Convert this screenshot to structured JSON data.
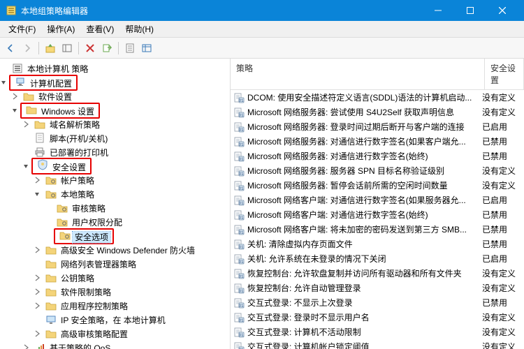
{
  "window": {
    "title": "本地组策略编辑器"
  },
  "menu": {
    "file": "文件(F)",
    "action": "操作(A)",
    "view": "查看(V)",
    "help": "帮助(H)"
  },
  "tree": {
    "root_label": "本地计算机 策略",
    "computer_config": "计算机配置",
    "software_settings": "软件设置",
    "windows_settings": "Windows 设置",
    "name_resolution": "域名解析策略",
    "scripts": "脚本(开机/关机)",
    "deployed_printers": "已部署的打印机",
    "security_settings": "安全设置",
    "account_policies": "帐户策略",
    "local_policies": "本地策略",
    "audit_policy": "审核策略",
    "user_rights": "用户权限分配",
    "security_options": "安全选项",
    "windows_defender_fw": "高级安全 Windows Defender 防火墙",
    "network_list_mgr": "网络列表管理器策略",
    "public_key": "公钥策略",
    "software_restriction": "软件限制策略",
    "app_control": "应用程序控制策略",
    "ip_security": "IP 安全策略，在 本地计算机",
    "advanced_audit": "高级审核策略配置",
    "policy_qos": "基于策略的 QoS"
  },
  "list_header": {
    "policy": "策略",
    "security_setting": "安全设置"
  },
  "policies": [
    {
      "name": "DCOM: 使用安全描述符定义语言(SDDL)语法的计算机启动...",
      "setting": "没有定义"
    },
    {
      "name": "Microsoft 网络服务器: 尝试使用 S4U2Self 获取声明信息",
      "setting": "没有定义"
    },
    {
      "name": "Microsoft 网络服务器: 登录时间过期后断开与客户端的连接",
      "setting": "已启用"
    },
    {
      "name": "Microsoft 网络服务器: 对通信进行数字签名(如果客户端允...",
      "setting": "已禁用"
    },
    {
      "name": "Microsoft 网络服务器: 对通信进行数字签名(始终)",
      "setting": "已禁用"
    },
    {
      "name": "Microsoft 网络服务器: 服务器 SPN 目标名称验证级别",
      "setting": "没有定义"
    },
    {
      "name": "Microsoft 网络服务器: 暂停会话前所需的空闲时间数量",
      "setting": "没有定义"
    },
    {
      "name": "Microsoft 网络客户端: 对通信进行数字签名(如果服务器允...",
      "setting": "已启用"
    },
    {
      "name": "Microsoft 网络客户端: 对通信进行数字签名(始终)",
      "setting": "已禁用"
    },
    {
      "name": "Microsoft 网络客户端: 将未加密的密码发送到第三方 SMB...",
      "setting": "已禁用"
    },
    {
      "name": "关机: 清除虚拟内存页面文件",
      "setting": "已禁用"
    },
    {
      "name": "关机: 允许系统在未登录的情况下关闭",
      "setting": "已启用"
    },
    {
      "name": "恢复控制台: 允许软盘复制并访问所有驱动器和所有文件夹",
      "setting": "没有定义"
    },
    {
      "name": "恢复控制台: 允许自动管理登录",
      "setting": "没有定义"
    },
    {
      "name": "交互式登录: 不显示上次登录",
      "setting": "已禁用"
    },
    {
      "name": "交互式登录: 登录时不显示用户名",
      "setting": "没有定义"
    },
    {
      "name": "交互式登录: 计算机不活动限制",
      "setting": "没有定义"
    },
    {
      "name": "交互式登录: 计算机帐户锁定阈值",
      "setting": "没有定义"
    }
  ]
}
